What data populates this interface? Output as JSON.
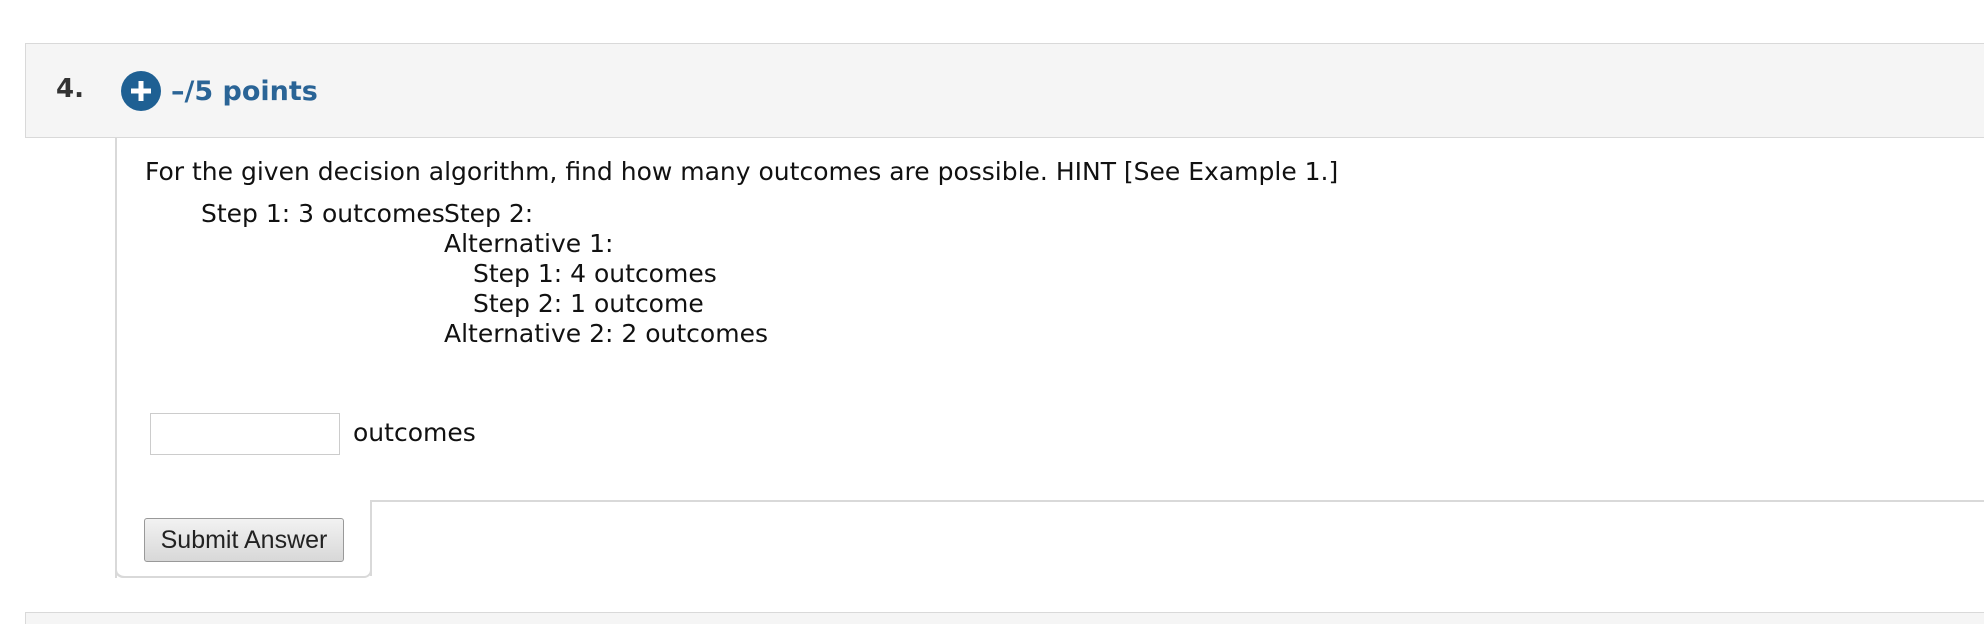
{
  "question": {
    "number": "4.",
    "points": "–/5 points",
    "prompt": "For the given decision algorithm, find how many outcomes are possible. HINT [See Example 1.]",
    "algorithm": {
      "step1": "Step 1: 3 outcomes",
      "step2": "Step 2:",
      "alt1": "Alternative 1:",
      "alt1_step1": "Step 1: 4 outcomes",
      "alt1_step2": "Step 2: 1 outcome",
      "alt2": "Alternative 2: 2 outcomes"
    },
    "answer": {
      "value": "",
      "unit": "outcomes"
    },
    "submit_label": "Submit Answer"
  },
  "icons": {
    "expand": "plus-circle-icon"
  },
  "colors": {
    "accent": "#1f6093",
    "points_text": "#2a6496",
    "header_bg": "#f5f5f5",
    "border": "#d9d9d9"
  }
}
